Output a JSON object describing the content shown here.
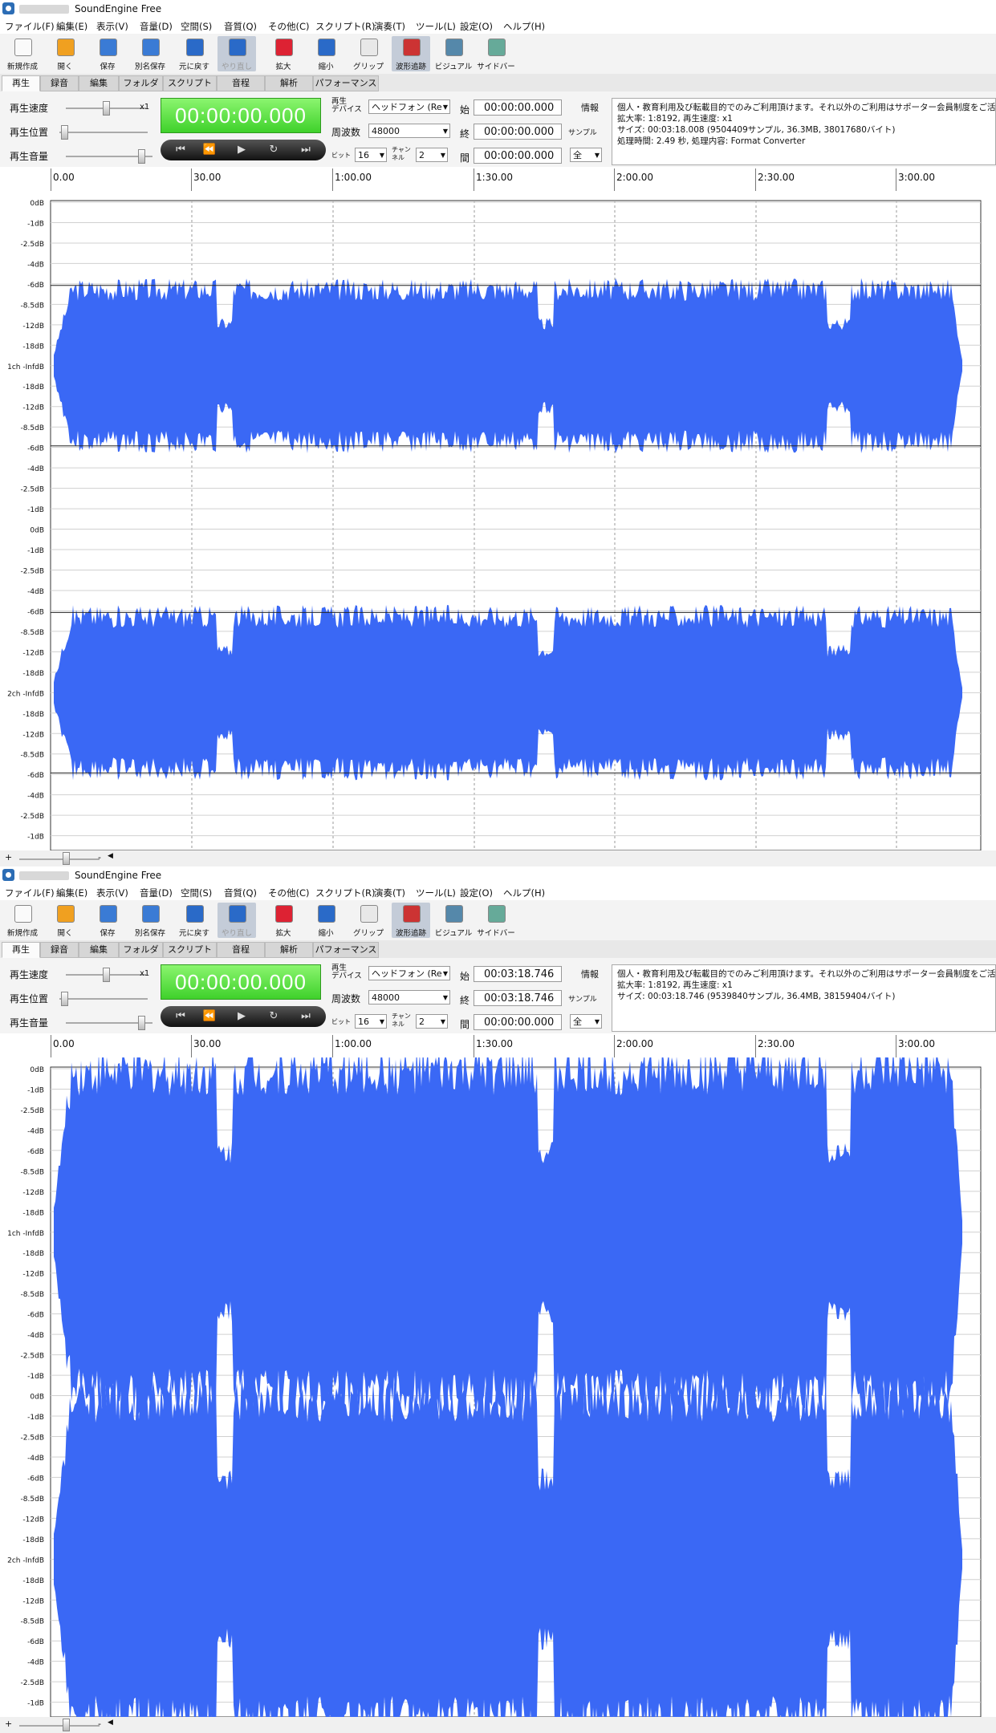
{
  "common": {
    "app_title": "SoundEngine Free",
    "menu": [
      "ファイル(F)",
      "編集(E)",
      "表示(V)",
      "音量(D)",
      "空間(S)",
      "音質(Q)",
      "その他(C)",
      "スクリプト(R)",
      "演奏(T)",
      "ツール(L)",
      "設定(O)",
      "ヘルプ(H)"
    ],
    "toolbar": [
      {
        "label": "新規作成",
        "icon": "new-file-icon"
      },
      {
        "label": "開く",
        "icon": "folder-open-icon"
      },
      {
        "label": "保存",
        "icon": "save-icon"
      },
      {
        "label": "別名保存",
        "icon": "save-as-icon"
      },
      {
        "label": "元に戻す",
        "icon": "undo-icon"
      },
      {
        "label": "やり直し",
        "icon": "redo-icon"
      },
      {
        "label": "拡大",
        "icon": "zoom-in-icon"
      },
      {
        "label": "縮小",
        "icon": "zoom-out-icon"
      },
      {
        "label": "グリップ",
        "icon": "grip-hand-icon"
      },
      {
        "label": "波形追跡",
        "icon": "waveform-track-icon"
      },
      {
        "label": "ビジュアル",
        "icon": "visual-icon"
      },
      {
        "label": "サイドバー",
        "icon": "sidebar-icon"
      }
    ],
    "tabs": [
      "再生",
      "録音",
      "編集",
      "フォルダ",
      "スクリプト",
      "音程",
      "解析",
      "パフォーマンス"
    ],
    "labels": {
      "speed": "再生速度",
      "position": "再生位置",
      "volume": "再生音量",
      "speed_val": "x1",
      "device": "再生\nデバイス",
      "freq": "周波数",
      "bit": "ビット",
      "channel": "チャン\nネル",
      "start": "始",
      "end": "終",
      "span": "間",
      "info": "情報",
      "sample": "サンプル"
    },
    "device_value": "ヘッドフォン (Re",
    "freq_value": "48000",
    "bit_value": "16",
    "channel_value": "2",
    "span_unit": "全",
    "timer": "00:00:00.000",
    "ruler_labels": [
      "0.00",
      "30.00",
      "1:00.00",
      "1:30.00",
      "2:00.00",
      "2:30.00",
      "3:00.00"
    ],
    "db_labels": [
      "0dB",
      "-1dB",
      "-2.5dB",
      "-4dB",
      "-6dB",
      "-8.5dB",
      "-12dB",
      "-18dB",
      "1ch -InfdB",
      "-18dB",
      "-12dB",
      "-8.5dB",
      "-6dB",
      "-4dB",
      "-2.5dB",
      "-1dB",
      "0dB",
      "-1dB",
      "-2.5dB",
      "-4dB",
      "-6dB",
      "-8.5dB",
      "-12dB",
      "-18dB",
      "2ch -InfdB",
      "-18dB",
      "-12dB",
      "-8.5dB",
      "-6dB",
      "-4dB",
      "-2.5dB",
      "-1dB"
    ],
    "scroll": {
      "plus": "+",
      "minus": "-"
    },
    "colors": {
      "wave": "#3a68f5",
      "timer": "#4cd834"
    }
  },
  "windows": [
    {
      "start_time": "00:00:00.000",
      "end_time": "00:00:00.000",
      "span_time": "00:00:00.000",
      "info_lines": [
        "個人・教育利用及び転載目的でのみご利用頂けます。それ以外のご利用はサポーター会員制度をご活用下さい。",
        "拡大率: 1:8192, 再生速度: x1",
        "サイズ: 00:03:18.008 (9504409サンプル, 36.3MB, 38017680バイト)",
        "処理時間: 2.49 秒, 処理内容: Format Converter"
      ],
      "waveform": "quiet"
    },
    {
      "start_time": "00:03:18.746",
      "end_time": "00:03:18.746",
      "span_time": "00:00:00.000",
      "info_lines": [
        "個人・教育利用及び転載目的でのみご利用頂けます。それ以外のご利用はサポーター会員制度をご活用下さい。",
        "拡大率: 1:8192, 再生速度: x1",
        "サイズ: 00:03:18.746 (9539840サンプル, 36.4MB, 38159404バイト)"
      ],
      "waveform": "loud"
    }
  ]
}
